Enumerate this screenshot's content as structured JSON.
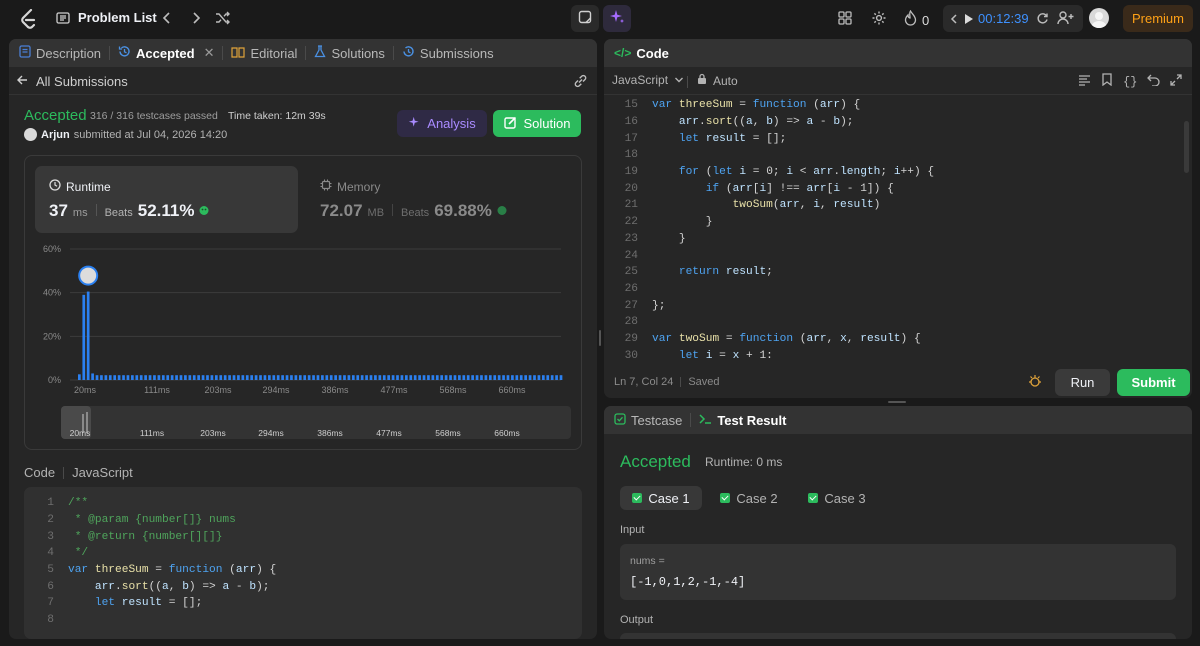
{
  "topbar": {
    "problem_list": "Problem List",
    "streak": "0",
    "timer": "00:12:39",
    "premium": "Premium"
  },
  "left_tabs": {
    "description": "Description",
    "accepted": "Accepted",
    "editorial": "Editorial",
    "solutions": "Solutions",
    "submissions": "Submissions"
  },
  "submission": {
    "back_label": "All Submissions",
    "status": "Accepted",
    "testcases": "316 / 316 testcases passed",
    "time_taken": "Time taken: 12m 39s",
    "user": "Arjun",
    "submitted_at": "submitted at Jul 04, 2026 14:20",
    "analysis_label": "Analysis",
    "solution_label": "Solution"
  },
  "runtime": {
    "label": "Runtime",
    "value": "37",
    "unit": "ms",
    "beats_label": "Beats",
    "beats": "52.11%"
  },
  "memory": {
    "label": "Memory",
    "value": "72.07",
    "unit": "MB",
    "beats_label": "Beats",
    "beats": "69.88%"
  },
  "chart_data": {
    "type": "bar",
    "y_ticks": [
      "60%",
      "40%",
      "20%",
      "0%"
    ],
    "ylim": [
      0,
      60
    ],
    "x_ticks": [
      "20ms",
      "111ms",
      "203ms",
      "294ms",
      "386ms",
      "477ms",
      "568ms",
      "660ms"
    ],
    "values": [
      2.6,
      39,
      40.5,
      3.0,
      2.2,
      2.2,
      2.2,
      2.2,
      2.2,
      2.2,
      2.2,
      2.2,
      2.2,
      2.2,
      2.2,
      2.2,
      2.2,
      2.2,
      2.2,
      2.2,
      2.2,
      2.2,
      2.2,
      2.2,
      2.2,
      2.2,
      2.2,
      2.2,
      2.2,
      2.2,
      2.2,
      2.2,
      2.2,
      2.2,
      2.2,
      2.2,
      2.2,
      2.2,
      2.2,
      2.2,
      2.2,
      2.2,
      2.2,
      2.2,
      2.2,
      2.2,
      2.2,
      2.2,
      2.2,
      2.2,
      2.2,
      2.2,
      2.2,
      2.2,
      2.2,
      2.2,
      2.2,
      2.2,
      2.2,
      2.2,
      2.2,
      2.2,
      2.2,
      2.2,
      2.2,
      2.2,
      2.2,
      2.2,
      2.2,
      2.2,
      2.2,
      2.2,
      2.2,
      2.2,
      2.2,
      2.2,
      2.2,
      2.2,
      2.2,
      2.2,
      2.2,
      2.2,
      2.2,
      2.2,
      2.2,
      2.2,
      2.2,
      2.2,
      2.2,
      2.2,
      2.2,
      2.2,
      2.2,
      2.2,
      2.2,
      2.2,
      2.2,
      2.2,
      2.2,
      2.2,
      2.2,
      2.2,
      2.2,
      2.2,
      2.2,
      2.2,
      2.2,
      2.2,
      2.2,
      2.2
    ],
    "bar_color": "#2b80f0",
    "highlight_index": 2,
    "grid": true
  },
  "code_section": {
    "label": "Code",
    "lang": "JavaScript",
    "lines": [
      {
        "n": "1",
        "t": "/**"
      },
      {
        "n": "2",
        "t": " * @param {number[]} nums"
      },
      {
        "n": "3",
        "t": " * @return {number[][]}"
      },
      {
        "n": "4",
        "t": " */"
      },
      {
        "n": "5",
        "t": "var threeSum = function (arr) {"
      },
      {
        "n": "6",
        "t": "    arr.sort((a, b) => a - b);"
      },
      {
        "n": "7",
        "t": "    let result = [];"
      },
      {
        "n": "8",
        "t": ""
      }
    ]
  },
  "editor": {
    "title": "Code",
    "lang": "JavaScript",
    "mode": "Auto",
    "lines": [
      {
        "n": "15",
        "t": "var threeSum = function (arr) {"
      },
      {
        "n": "16",
        "t": "    arr.sort((a, b) => a - b);"
      },
      {
        "n": "17",
        "t": "    let result = [];"
      },
      {
        "n": "18",
        "t": ""
      },
      {
        "n": "19",
        "t": "    for (let i = 0; i < arr.length; i++) {"
      },
      {
        "n": "20",
        "t": "        if (arr[i] !== arr[i - 1]) {"
      },
      {
        "n": "21",
        "t": "            twoSum(arr, i, result)"
      },
      {
        "n": "22",
        "t": "        }"
      },
      {
        "n": "23",
        "t": "    }"
      },
      {
        "n": "24",
        "t": ""
      },
      {
        "n": "25",
        "t": "    return result;"
      },
      {
        "n": "26",
        "t": ""
      },
      {
        "n": "27",
        "t": "};"
      },
      {
        "n": "28",
        "t": ""
      },
      {
        "n": "29",
        "t": "var twoSum = function (arr, x, result) {"
      },
      {
        "n": "30",
        "t": "    let i = x + 1:"
      }
    ],
    "position": "Ln 7, Col 24",
    "saved": "Saved",
    "run": "Run",
    "submit": "Submit"
  },
  "result": {
    "testcase_tab": "Testcase",
    "result_tab": "Test Result",
    "status": "Accepted",
    "runtime": "Runtime: 0 ms",
    "cases": [
      "Case 1",
      "Case 2",
      "Case 3"
    ],
    "input_label": "Input",
    "var_name": "nums =",
    "var_value": "[-1,0,1,2,-1,-4]",
    "output_label": "Output"
  },
  "colors": {
    "accent_green": "#2cbb5d",
    "bar_blue": "#2b80f0",
    "premium": "#ffa116"
  }
}
